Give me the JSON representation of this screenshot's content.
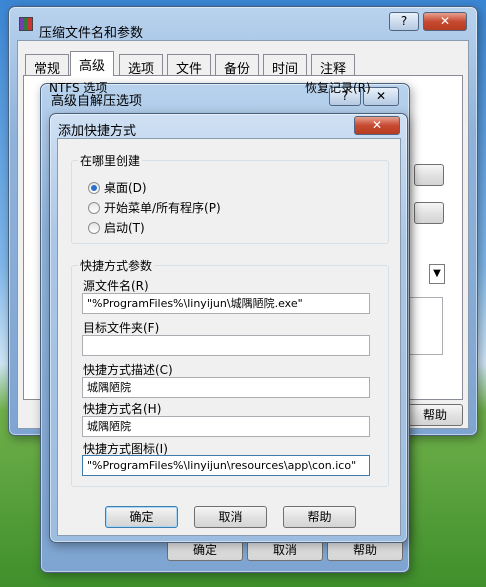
{
  "main_window": {
    "title": "压缩文件名和参数",
    "help_btn": "?",
    "close_btn": "✕",
    "tabs": [
      "常规",
      "高级",
      "选项",
      "文件",
      "备份",
      "时间",
      "注释"
    ],
    "bg_label_ntfs": "NTFS 选项",
    "bg_label_right": "恢复记录(R)",
    "ok": "确定",
    "cancel": "取消",
    "help": "帮助"
  },
  "sfx_window": {
    "title": "高级自解压选项",
    "help_btn": "?",
    "close_btn": "✕"
  },
  "dialog": {
    "title": "添加快捷方式",
    "close_btn": "✕",
    "where_group": "在哪里创建",
    "where_options": [
      "桌面(D)",
      "开始菜单/所有程序(P)",
      "启动(T)"
    ],
    "params_group": "快捷方式参数",
    "src_label": "源文件名(R)",
    "src_value": "\"%ProgramFiles%\\linyijun\\城隅陋院.exe\"",
    "dest_label": "目标文件夹(F)",
    "dest_value": "",
    "desc_label": "快捷方式描述(C)",
    "desc_value": "城隅陋院",
    "name_label": "快捷方式名(H)",
    "name_value": "城隅陋院",
    "icon_label": "快捷方式图标(I)",
    "icon_value": "\"%ProgramFiles%\\linyijun\\resources\\app\\con.ico\"",
    "ok": "确定",
    "cancel": "取消",
    "help": "帮助"
  }
}
